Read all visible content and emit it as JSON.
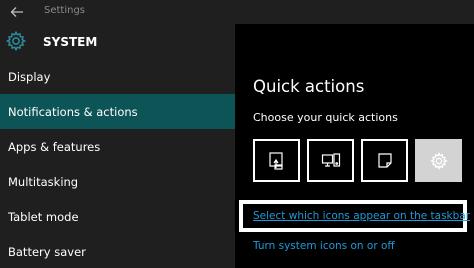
{
  "window": {
    "title": "Settings"
  },
  "sidebar": {
    "header_title": "SYSTEM",
    "items": [
      {
        "label": "Display",
        "selected": false
      },
      {
        "label": "Notifications & actions",
        "selected": true
      },
      {
        "label": "Apps & features",
        "selected": false
      },
      {
        "label": "Multitasking",
        "selected": false
      },
      {
        "label": "Tablet mode",
        "selected": false
      },
      {
        "label": "Battery saver",
        "selected": false
      }
    ]
  },
  "main": {
    "title": "Quick actions",
    "subtitle": "Choose your quick actions",
    "tiles": [
      {
        "icon": "tablet-mode-icon"
      },
      {
        "icon": "connect-icon"
      },
      {
        "icon": "note-icon"
      },
      {
        "icon": "settings-gear-icon"
      }
    ],
    "link_taskbar_icons": "Select which icons appear on the taskbar",
    "link_system_icons": "Turn system icons on or off"
  },
  "colors": {
    "accent": "#0d5457",
    "link": "#1e9bd6",
    "sidebar_bg": "#1f1f1f",
    "main_bg": "#000000"
  }
}
